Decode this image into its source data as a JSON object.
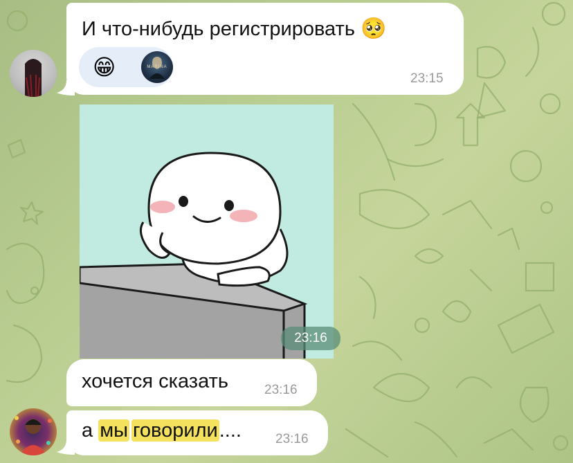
{
  "chat": {
    "background_color": "#b6ca8e",
    "bubble_color": "#ffffff",
    "highlight_color": "#f4e25f"
  },
  "messages": [
    {
      "text": "И что-нибудь регистрировать",
      "emoji": "🥺",
      "time": "23:15",
      "reactions": [
        {
          "emoji": "😁",
          "icon": "grinning-face-emoji"
        },
        {
          "icon": "reactor-avatar",
          "label": "MARINA"
        }
      ]
    },
    {
      "type": "sticker",
      "icon": "cute-blob-thinking-sticker",
      "time": "23:16"
    },
    {
      "text": "хочется сказать",
      "time": "23:16"
    },
    {
      "text_parts": [
        "а",
        "мы",
        "говорили",
        "...."
      ],
      "time": "23:16"
    }
  ]
}
